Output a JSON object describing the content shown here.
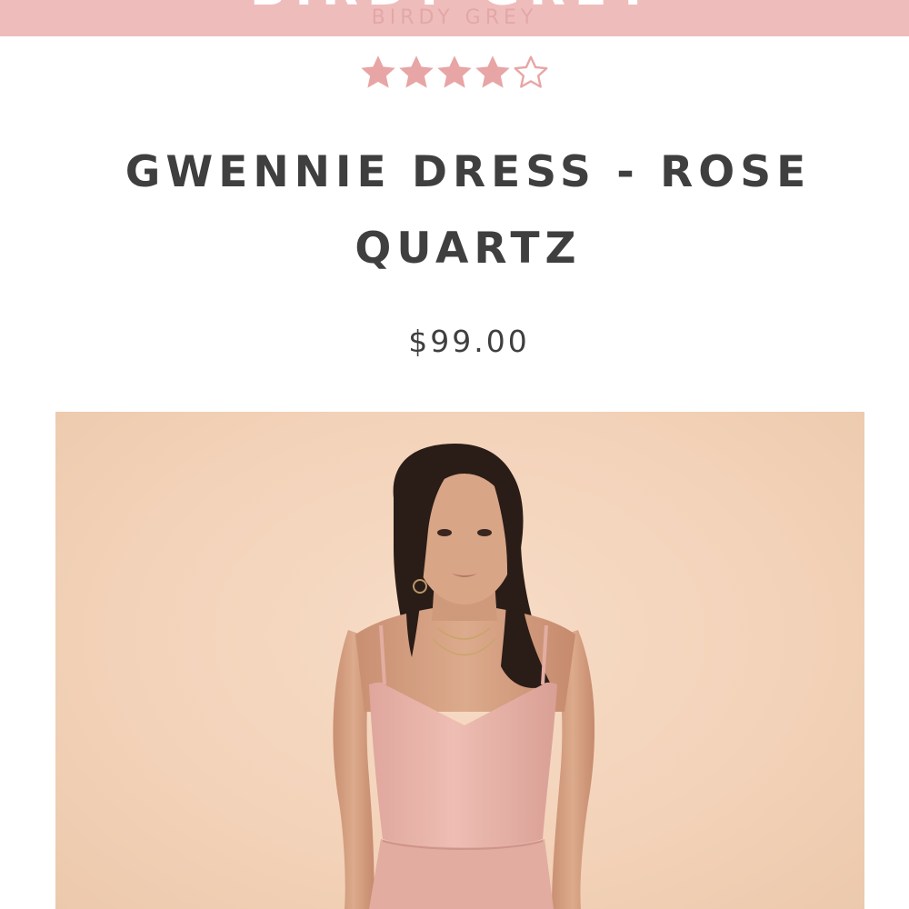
{
  "header": {
    "brand_name": "BIRDY GREY",
    "brand_subtitle": "BIRDY GREY",
    "background_color": "#efbcbc"
  },
  "product": {
    "rating": {
      "value": 4.5,
      "max": 5,
      "star_color": "#e8a5a5"
    },
    "title": "GWENNIE DRESS - ROSE QUARTZ",
    "price": "$99.00",
    "image": {
      "subject": "model-wearing-dress",
      "dress_color": "#e9b7ad",
      "background_color": "#f3d3ba"
    }
  }
}
